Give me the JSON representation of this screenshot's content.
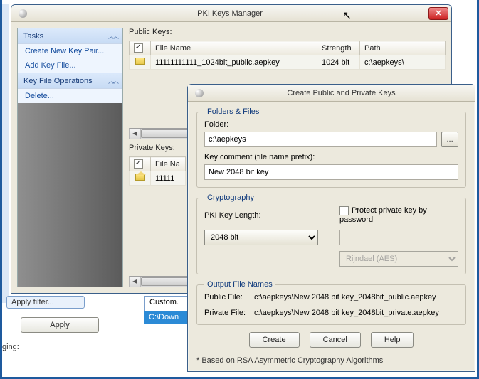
{
  "pki": {
    "title": "PKI Keys Manager",
    "public_label": "Public Keys:",
    "private_label": "Private Keys:",
    "cols": {
      "check": "✓",
      "file": "File Name",
      "strength": "Strength",
      "path": "Path"
    },
    "public_rows": [
      {
        "file": "11111111111_1024bit_public.aepkey",
        "strength": "1024 bit",
        "path": "c:\\aepkeys\\"
      }
    ],
    "private_cols": {
      "file": "File Na"
    },
    "private_rows": [
      {
        "file": "11111"
      }
    ]
  },
  "sidebar": {
    "tasks_hdr": "Tasks",
    "items": [
      {
        "label": "Create New Key Pair..."
      },
      {
        "label": "Add Key File..."
      }
    ],
    "ops_hdr": "Key File Operations",
    "ops": [
      {
        "label": "Delete..."
      }
    ]
  },
  "bg": {
    "apply_filter": "Apply filter...",
    "custom": "Custom.",
    "dlpath": "C:\\Down",
    "apply": "Apply",
    "ging": "ging:"
  },
  "dlg": {
    "title": "Create Public and Private Keys",
    "folders_legend": "Folders & Files",
    "folder_label": "Folder:",
    "folder_value": "c:\\aepkeys",
    "browse": "...",
    "comment_label": "Key comment (file name prefix):",
    "comment_value": "New 2048 bit key",
    "crypto_legend": "Cryptography",
    "keylen_label": "PKI Key Length:",
    "keylen_value": "2048 bit",
    "protect_label": "Protect private key by password",
    "password_value": "",
    "algo_value": "Rijndael (AES)",
    "out_legend": "Output File Names",
    "public_file_label": "Public File:",
    "public_file_value": "c:\\aepkeys\\New 2048 bit key_2048bit_public.aepkey",
    "private_file_label": "Private File:",
    "private_file_value": "c:\\aepkeys\\New 2048 bit key_2048bit_private.aepkey",
    "create": "Create",
    "cancel": "Cancel",
    "help": "Help",
    "footnote": "* Based on RSA Asymmetric Cryptography Algorithms"
  }
}
